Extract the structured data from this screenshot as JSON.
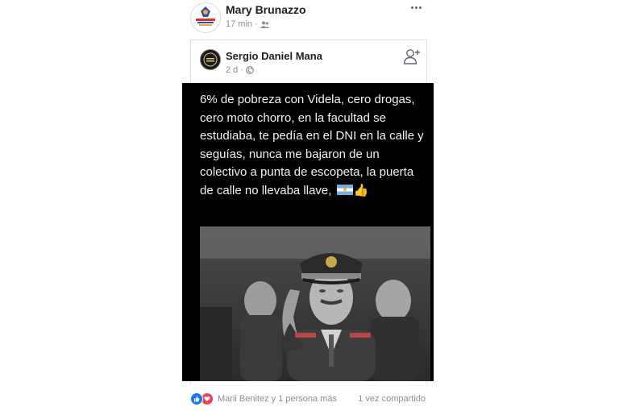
{
  "outer_post": {
    "author": "Mary Brunazzo",
    "time": "17 min",
    "separator": "·",
    "audience_icon": "friends-icon",
    "avatar_logo_text": "FRENTE DESPERTAR",
    "more_icon": "more-icon"
  },
  "shared_post": {
    "author": "Sergio Daniel Mana",
    "time": "2 d",
    "separator": "·",
    "audience_icon": "globe-icon",
    "add_friend_icon": "add-friend-icon",
    "text": "6% de pobreza con Videla, cero drogas, cero moto chorro, en la facultad se estudiaba, te pedía en el DNI en la calle y seguías, nunca me bajaron de un colectivo a punta de escopeta, la puerta de calle no llevaba llave,",
    "emoji": [
      "argentina-flag-emoji",
      "thumbs-up-emoji"
    ],
    "image_alt": "photo of uniformed military officer saluting"
  },
  "footer": {
    "reactions": [
      "like-icon",
      "love-icon"
    ],
    "reactors": "Marii Benitez y 1 persona más",
    "shares": "1 vez compartido"
  },
  "colors": {
    "name": "#1c1e21",
    "meta": "#8a8d91",
    "like": "#1877f2",
    "love": "#f33e58",
    "card_bg": "#000000"
  }
}
